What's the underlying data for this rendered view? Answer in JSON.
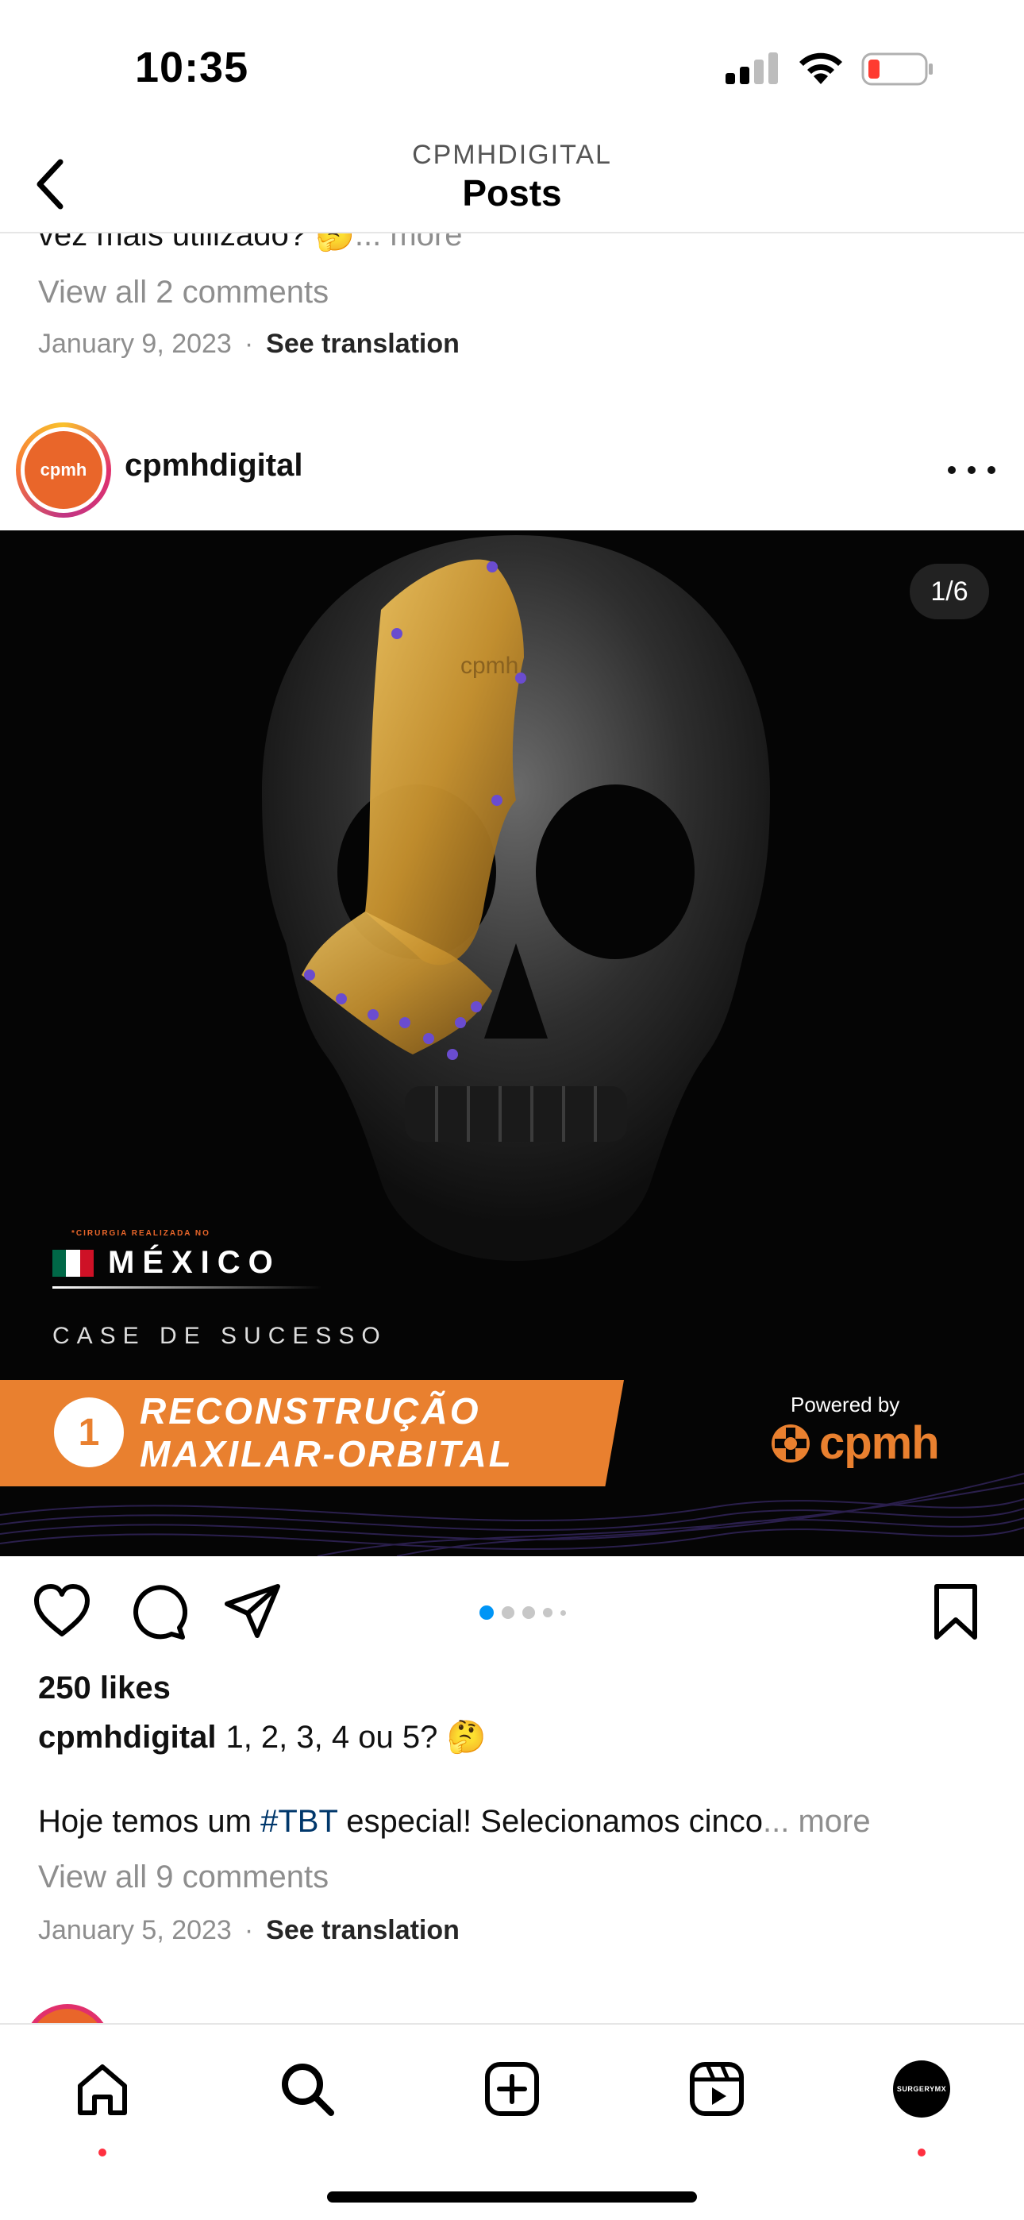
{
  "status_bar": {
    "time": "10:35"
  },
  "header": {
    "account": "CPMHDIGITAL",
    "title": "Posts"
  },
  "previous_post": {
    "caption_tail": "vez mais utilizado? 🤔",
    "more": "... more",
    "view_comments": "View all 2 comments",
    "date": "January 9, 2023",
    "see_translation": "See translation"
  },
  "post": {
    "username": "cpmhdigital",
    "avatar_text": "cpmh",
    "slide_counter": "1/6",
    "image": {
      "country_small": "*CIRURGIA REALIZADA NO",
      "country": "MÉXICO",
      "case_label": "CASE DE SUCESSO",
      "number": "1",
      "title_line1": "RECONSTRUÇÃO",
      "title_line2": "MAXILAR-ORBITAL",
      "powered_by": "Powered by",
      "brand": "cpmh",
      "skull_plate_text": "cpmh"
    },
    "likes": "250 likes",
    "caption_user": "cpmhdigital",
    "caption_first": "1, 2, 3, 4 ou 5? 🤔",
    "caption_body_pre": "Hoje temos um ",
    "caption_hashtag": "#TBT",
    "caption_body_post": " especial! Selecionamos cinco",
    "more": "... more",
    "view_comments": "View all 9 comments",
    "date": "January 5, 2023",
    "see_translation": "See translation",
    "carousel": {
      "total": 5,
      "active_index": 0
    }
  },
  "tab_bar": {
    "items": [
      {
        "name": "home",
        "has_dot": true
      },
      {
        "name": "search",
        "has_dot": false
      },
      {
        "name": "create",
        "has_dot": false
      },
      {
        "name": "reels",
        "has_dot": false
      },
      {
        "name": "profile",
        "has_dot": true
      }
    ],
    "profile_text": "SURGERYMX"
  },
  "colors": {
    "accent_orange": "#e9802f",
    "link_blue": "#00376b",
    "notification_red": "#ff3040",
    "carousel_active": "#0095f6"
  }
}
